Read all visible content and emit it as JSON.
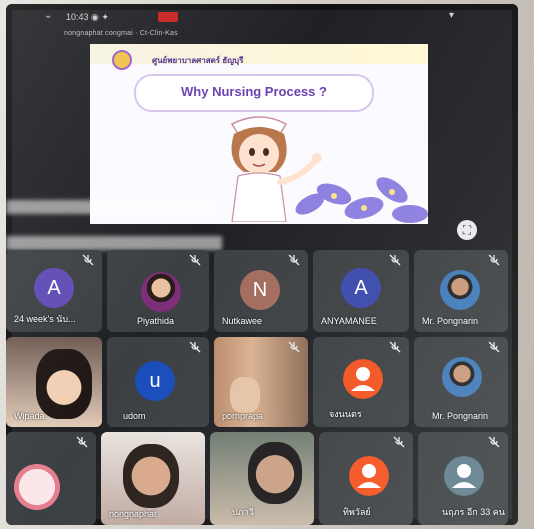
{
  "status": {
    "time": "10:43 ◉ ✦",
    "back": "⌄"
  },
  "meeting": {
    "title": "nongnaphat congmai · Ct-Clin-Kas"
  },
  "presentation": {
    "org_name": "ศูนย์พยาบาลศาสตร์ ธัญบุรี",
    "title": "Why Nursing Process ?"
  },
  "colors": {
    "tile_bg": "#3c4043",
    "avatar_purple": "#5f4bb6",
    "avatar_brown": "#a36c5d",
    "avatar_blue": "#3949ab",
    "avatar_orange": "#f4511e",
    "mute_icon": "#e8eaed"
  },
  "participants": [
    {
      "name": "24 week's นับ...",
      "avatar": "A"
    },
    {
      "name": "Piyathida",
      "avatar": ""
    },
    {
      "name": "Nutkawee",
      "avatar": "N"
    },
    {
      "name": "ANYAMANEE",
      "avatar": "A"
    },
    {
      "name": "Mr. Pongnarin",
      "avatar": ""
    },
    {
      "name": "Wipada",
      "avatar": ""
    },
    {
      "name": "udom",
      "avatar": "u"
    },
    {
      "name": "pornprapa",
      "avatar": ""
    },
    {
      "name": "จงนนตร",
      "avatar": ""
    },
    {
      "name": "Mr. Pongnarin",
      "avatar": ""
    },
    {
      "name": "",
      "avatar": ""
    },
    {
      "name": "nongnaphat",
      "avatar": ""
    },
    {
      "name": "ปภาวี",
      "avatar": ""
    },
    {
      "name": "ทิพวัลย์",
      "avatar": ""
    },
    {
      "name": "นฤภร  อีก 33 คน",
      "avatar": ""
    }
  ]
}
